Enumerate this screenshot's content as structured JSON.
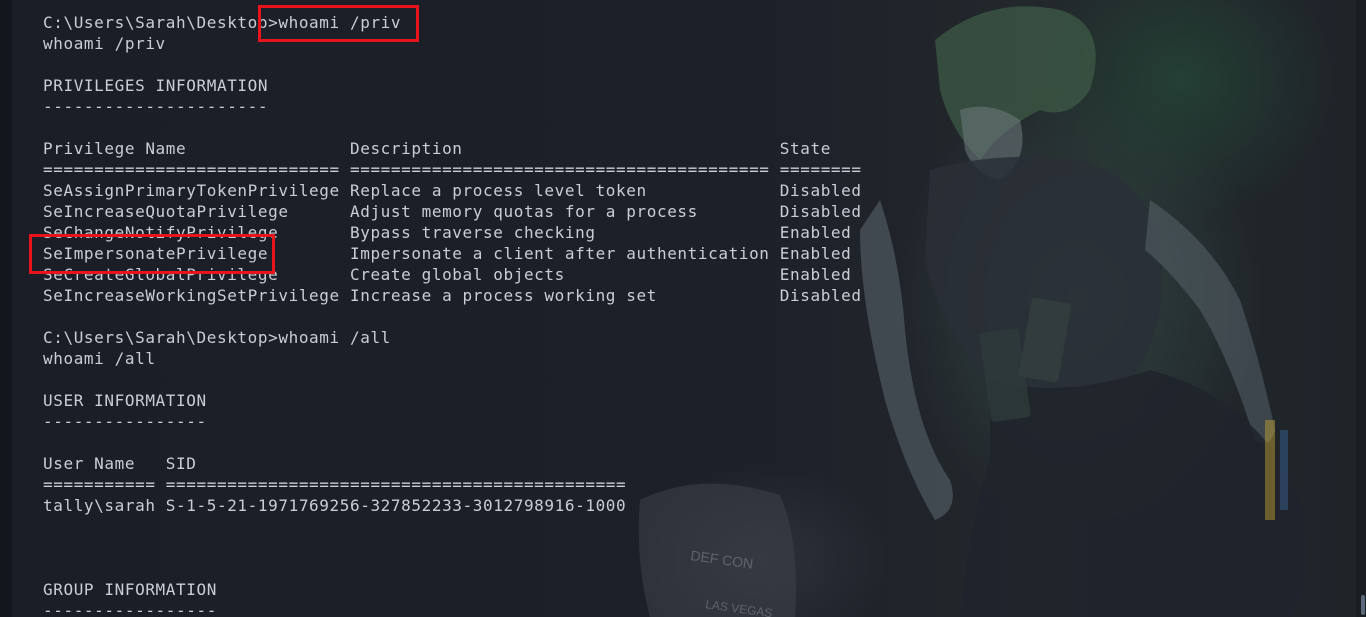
{
  "colors": {
    "text": "#c9ced6",
    "background": "#1a1d26",
    "highlight": "#e8141b"
  },
  "terminal": {
    "lines": [
      "C:\\Users\\Sarah\\Desktop>whoami /priv",
      "whoami /priv",
      "",
      "PRIVILEGES INFORMATION",
      "----------------------",
      "",
      "Privilege Name                Description                               State",
      "============================= ========================================= ========",
      "SeAssignPrimaryTokenPrivilege Replace a process level token             Disabled",
      "SeIncreaseQuotaPrivilege      Adjust memory quotas for a process        Disabled",
      "SeChangeNotifyPrivilege       Bypass traverse checking                  Enabled",
      "SeImpersonatePrivilege        Impersonate a client after authentication Enabled",
      "SeCreateGlobalPrivilege       Create global objects                     Enabled",
      "SeIncreaseWorkingSetPrivilege Increase a process working set            Disabled",
      "",
      "C:\\Users\\Sarah\\Desktop>whoami /all",
      "whoami /all",
      "",
      "USER INFORMATION",
      "----------------",
      "",
      "User Name   SID",
      "=========== =============================================",
      "tally\\sarah S-1-5-21-1971769256-327852233-3012798916-1000",
      "",
      "",
      "",
      "GROUP INFORMATION",
      "-----------------"
    ]
  },
  "background_art": {
    "labels": [
      "DEF CON",
      "LAS VEGAS"
    ]
  }
}
